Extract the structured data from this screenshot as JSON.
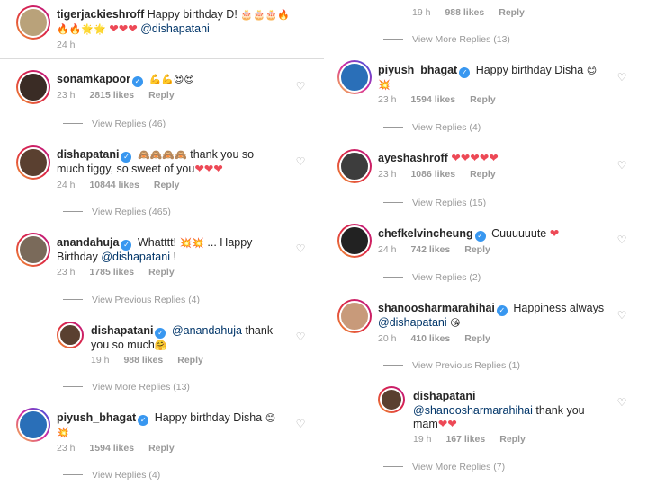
{
  "left": {
    "top": {
      "user": "tigerjackieshroff",
      "text": "Happy birthday D!",
      "emoji1": "🎂🎂🎂🔥",
      "emoji2": "🔥🔥🌟🌟",
      "hearts": "❤❤❤",
      "mention": "@dishapatani",
      "time": "24 h"
    },
    "c1": {
      "user": "sonamkapoor",
      "text": "💪💪😍😍",
      "time": "23 h",
      "likes": "2815 likes",
      "reply": "Reply",
      "view": "View Replies (46)"
    },
    "c2": {
      "user": "dishapatani",
      "emoji": "🙈🙈🙈🙈",
      "text": "thank you so",
      "text2": "much tiggy, so sweet of you",
      "hearts": "❤❤❤",
      "time": "24 h",
      "likes": "10844 likes",
      "reply": "Reply",
      "view": "View Replies (465)"
    },
    "c3": {
      "user": "anandahuja",
      "text": "Whatttt!",
      "emoji": "💥💥",
      "text_b": "... Happy",
      "text2": "Birthday",
      "mention": "@dishapatani",
      "text2b": "!",
      "time": "23 h",
      "likes": "1785 likes",
      "reply": "Reply",
      "view": "View Previous Replies (4)"
    },
    "r1": {
      "user": "dishapatani",
      "mention": "@anandahuja",
      "text": "thank",
      "text2": "you so much",
      "emoji": "🤗",
      "time": "19 h",
      "likes": "988 likes",
      "reply": "Reply",
      "view": "View More Replies (13)"
    },
    "c4": {
      "user": "piyush_bhagat",
      "text": "Happy birthday Disha",
      "emoji": "😊",
      "emoji2": "💥",
      "time": "23 h",
      "likes": "1594 likes",
      "reply": "Reply",
      "view": "View Replies (4)"
    }
  },
  "right": {
    "top": {
      "time": "19 h",
      "likes": "988 likes",
      "reply": "Reply",
      "view": "View More Replies (13)"
    },
    "c1": {
      "user": "piyush_bhagat",
      "text": "Happy birthday Disha",
      "emoji": "😊",
      "emoji2": "💥",
      "time": "23 h",
      "likes": "1594 likes",
      "reply": "Reply",
      "view": "View Replies (4)"
    },
    "c2": {
      "user": "ayeshashroff",
      "hearts": "❤❤❤❤❤",
      "time": "23 h",
      "likes": "1086 likes",
      "reply": "Reply",
      "view": "View Replies (15)"
    },
    "c3": {
      "user": "chefkelvincheung",
      "text": "Cuuuuuute",
      "hearts": "❤",
      "time": "24 h",
      "likes": "742 likes",
      "reply": "Reply",
      "view": "View Replies (2)"
    },
    "c4": {
      "user": "shanoosharmarahihai",
      "text": "Happiness always",
      "mention": "@dishapatani",
      "emoji": "😘",
      "time": "20 h",
      "likes": "410 likes",
      "reply": "Reply",
      "view": "View Previous Replies (1)"
    },
    "r1": {
      "user": "dishapatani",
      "mention": "@shanoosharmarahihai",
      "text": "thank you",
      "text2": "mam",
      "hearts": "❤❤",
      "time": "19 h",
      "likes": "167 likes",
      "reply": "Reply",
      "view": "View More Replies (7)"
    }
  },
  "icons": {
    "heart": "heart-outline-icon",
    "verified": "verified-badge-icon"
  },
  "colors": {
    "verified": "#3897f0",
    "meta": "#999999",
    "mention": "#003569",
    "heart_red": "#ed4956"
  }
}
